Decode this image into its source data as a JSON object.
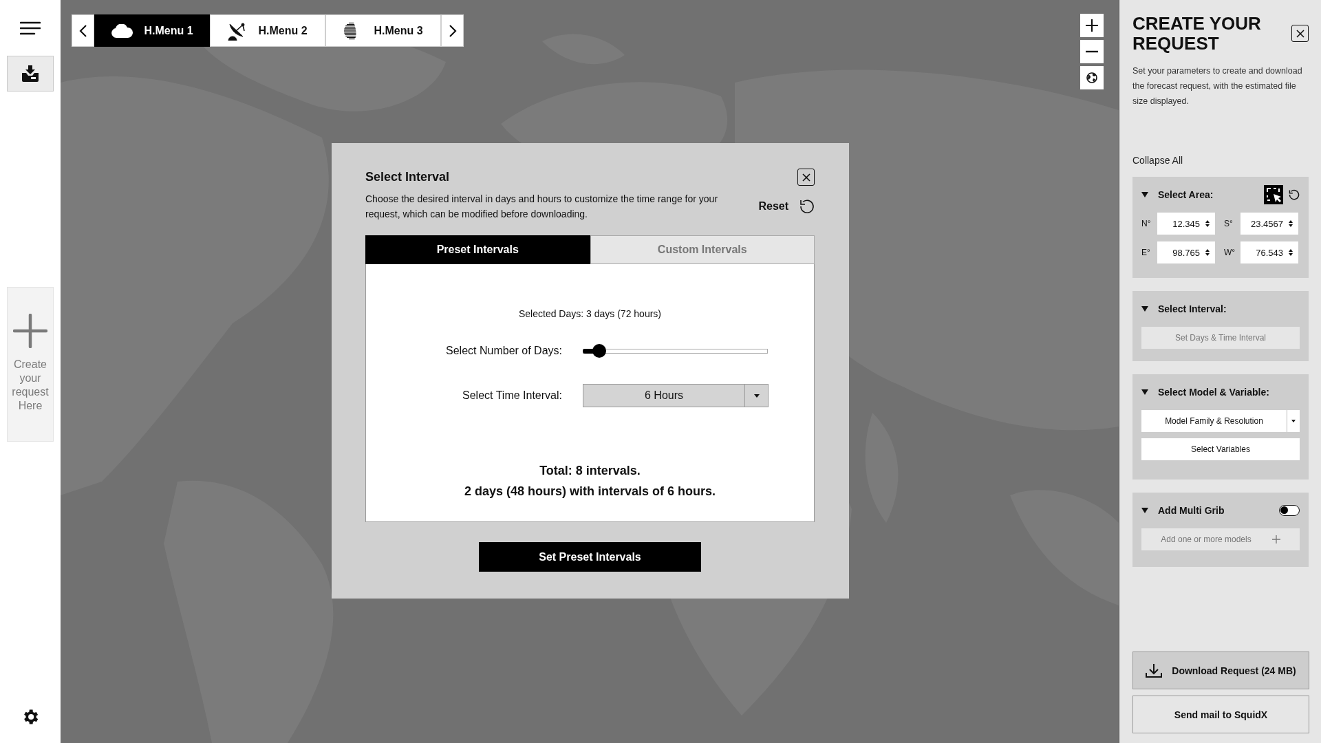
{
  "sidebar": {
    "create_label": "Create your request Here"
  },
  "menu_tabs": [
    {
      "label": "H.Menu 1",
      "selected": true
    },
    {
      "label": "H.Menu 2",
      "selected": false
    },
    {
      "label": "H.Menu 3",
      "selected": false
    }
  ],
  "modal": {
    "title": "Select Interval",
    "description": "Choose the desired interval in days and hours to customize the time range for your request, which can be modified before downloading.",
    "reset_label": "Reset",
    "tabs": [
      {
        "label": "Preset Intervals",
        "selected": true
      },
      {
        "label": "Custom Intervals",
        "selected": false
      }
    ],
    "selected_days": "Selected Days: 3 days (72 hours)",
    "days_label": "Select Number of Days:",
    "days_slider": {
      "level": 0.09
    },
    "interval_label": "Select Time Interval:",
    "interval_value": "6 Hours",
    "total_lines": [
      "Total: 8 intervals.",
      "2 days (48 hours) with intervals of 6 hours."
    ],
    "button": "Set Preset Intervals"
  },
  "panel": {
    "title": "CREATE YOUR REQUEST",
    "description": "Set your parameters to create and download the forecast request, with the estimated file size displayed.",
    "collapse_all": "Collapse All",
    "area": {
      "title": "Select Area:",
      "expanded": true,
      "coords": [
        {
          "label": "N°",
          "value": "12.345"
        },
        {
          "label": "S°",
          "value": "23.4567"
        },
        {
          "label": "E°",
          "value": "98.765"
        },
        {
          "label": "W°",
          "value": "76.543"
        }
      ]
    },
    "interval": {
      "title": "Select Interval:",
      "expanded": true,
      "button": "Set Days & Time Interval",
      "disabled": true
    },
    "model": {
      "title": "Select Model & Variable:",
      "expanded": true,
      "family": "Model Family & Resolution",
      "variables": "Select Variables"
    },
    "multi_grib": {
      "title": "Add Multi Grib",
      "expanded": true,
      "on": false,
      "button": "Add one or more models",
      "disabled": true
    },
    "download_button": "Download Request (24 MB)",
    "mail_button": "Send mail to SquidX"
  }
}
